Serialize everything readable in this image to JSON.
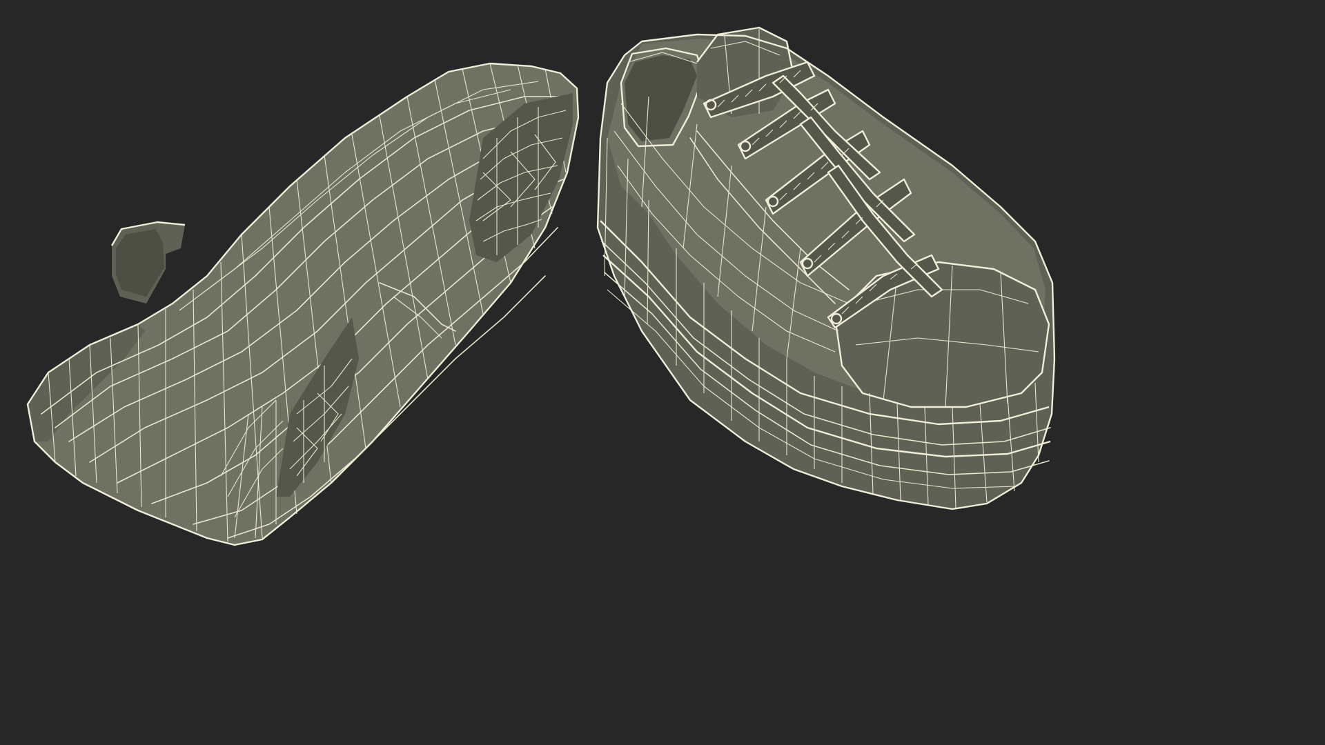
{
  "scene": {
    "background_color": "#272727",
    "mesh_fill_color": "#6f7163",
    "wire_color": "#e9e7cf",
    "objects": [
      {
        "name": "left-sneaker",
        "view": "sole"
      },
      {
        "name": "right-sneaker",
        "view": "top"
      }
    ]
  }
}
